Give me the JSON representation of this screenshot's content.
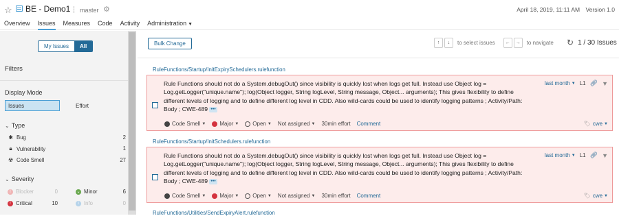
{
  "header": {
    "project_name": "BE - Demo1",
    "branch": "master",
    "date": "April 18, 2019, 11:11 AM",
    "version": "Version 1.0",
    "nav": [
      {
        "label": "Overview",
        "active": false
      },
      {
        "label": "Issues",
        "active": true
      },
      {
        "label": "Measures",
        "active": false
      },
      {
        "label": "Code",
        "active": false
      },
      {
        "label": "Activity",
        "active": false
      },
      {
        "label": "Administration",
        "active": false
      }
    ]
  },
  "sidebar": {
    "my_issues": "My Issues",
    "all": "All",
    "filters_title": "Filters",
    "display_mode": {
      "title": "Display Mode",
      "issues": "Issues",
      "effort": "Effort"
    },
    "type": {
      "title": "Type",
      "items": [
        {
          "label": "Bug",
          "count": "2"
        },
        {
          "label": "Vulnerability",
          "count": "1"
        },
        {
          "label": "Code Smell",
          "count": "27"
        }
      ]
    },
    "severity": {
      "title": "Severity",
      "items": [
        {
          "label": "Blocker",
          "count": "0"
        },
        {
          "label": "Minor",
          "count": "6"
        },
        {
          "label": "Critical",
          "count": "10"
        },
        {
          "label": "Info",
          "count": "0"
        }
      ]
    }
  },
  "toolbar": {
    "bulk_change": "Bulk Change",
    "select_hint": "to select issues",
    "navigate_hint": "to navigate",
    "counter": "1 / 30 Issues"
  },
  "issues": [
    {
      "component": "RuleFunctions/Startup/InitExpirySchedulers.rulefunction",
      "message": "Rule Functions should not do a System.debugOut() since visibility is quickly lost when logs get full. Instead use Object log = Log.getLogger(\"unique.name\"); log(Object logger, String logLevel, String message, Object... arguments); This gives flexibility to define different levels of logging and to define different log level in CDD. Also wild-cards could be used to identify logging patterns ; Activity/Path: Body ; CWE-489",
      "ellipsis": "•••",
      "type": "Code Smell",
      "severity": "Major",
      "status": "Open",
      "assignee": "Not assigned",
      "effort": "30min effort",
      "comment": "Comment",
      "date": "last month",
      "line": "L1",
      "tag": "cwe"
    },
    {
      "component": "RuleFunctions/Startup/InitSchedulers.rulefunction",
      "message": "Rule Functions should not do a System.debugOut() since visibility is quickly lost when logs get full. Instead use Object log = Log.getLogger(\"unique.name\"); log(Object logger, String logLevel, String message, Object... arguments); This gives flexibility to define different levels of logging and to define different log level in CDD. Also wild-cards could be used to identify logging patterns ; Activity/Path: Body ; CWE-489",
      "ellipsis": "•••",
      "type": "Code Smell",
      "severity": "Major",
      "status": "Open",
      "assignee": "Not assigned",
      "effort": "30min effort",
      "comment": "Comment",
      "date": "last month",
      "line": "L1",
      "tag": "cwe"
    }
  ],
  "next_component": "RuleFunctions/Utilities/SendExpiryAlert.rulefunction"
}
